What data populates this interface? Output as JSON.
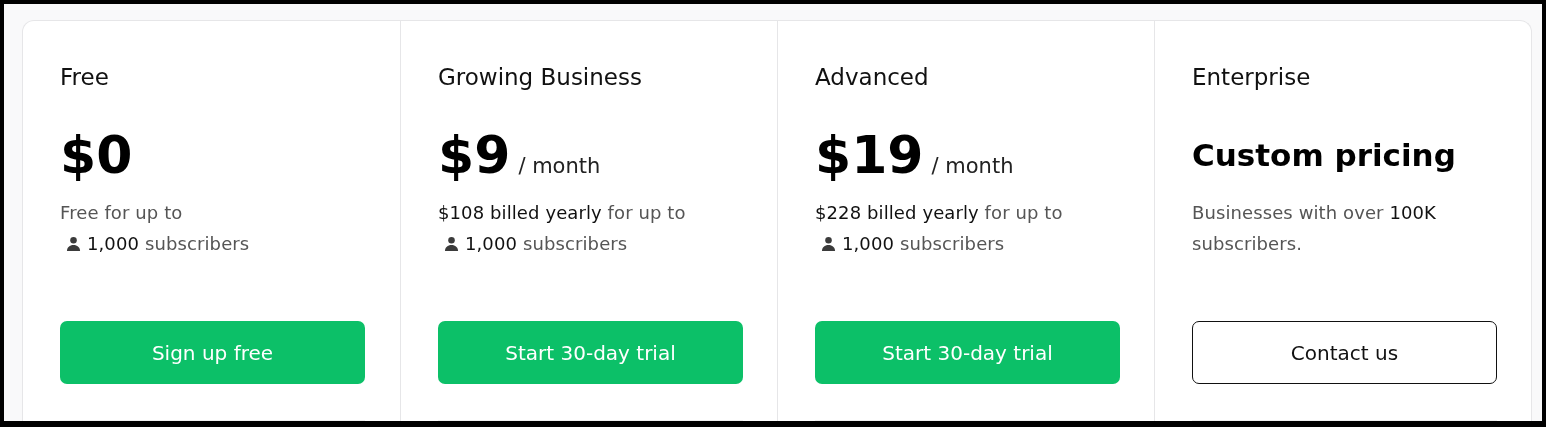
{
  "plans": [
    {
      "name": "Free",
      "price": {
        "text": "$0",
        "kind": "amount"
      },
      "description": [
        {
          "kind": "text",
          "text": "Free for up to"
        },
        {
          "kind": "subscribers",
          "text": "1,000"
        },
        {
          "kind": "text",
          "text": "subscribers"
        }
      ],
      "button": {
        "label": "Sign up free",
        "kind": "primary"
      }
    },
    {
      "name": "Growing Business",
      "price": {
        "text": "$9",
        "kind": "amount"
      },
      "period": "/ month",
      "description": [
        {
          "kind": "text",
          "text": "**$108 billed yearly** for up to"
        },
        {
          "kind": "subscribers",
          "text": "1,000"
        },
        {
          "kind": "text",
          "text": "subscribers"
        }
      ],
      "button": {
        "label": "Start 30-day trial",
        "kind": "primary"
      }
    },
    {
      "name": "Advanced",
      "price": {
        "text": "$19",
        "kind": "amount"
      },
      "period": "/ month",
      "description": [
        {
          "kind": "text",
          "text": "**$228 billed yearly** for up to"
        },
        {
          "kind": "subscribers",
          "text": "1,000"
        },
        {
          "kind": "text",
          "text": "subscribers"
        }
      ],
      "button": {
        "label": "Start 30-day trial",
        "kind": "primary"
      }
    },
    {
      "name": "Enterprise",
      "price": {
        "text": "Custom pricing",
        "kind": "custom"
      },
      "description": [
        {
          "kind": "text",
          "text": "Businesses with over **100K** subscribers."
        }
      ],
      "button": {
        "label": "Contact us",
        "kind": "outline"
      }
    }
  ]
}
